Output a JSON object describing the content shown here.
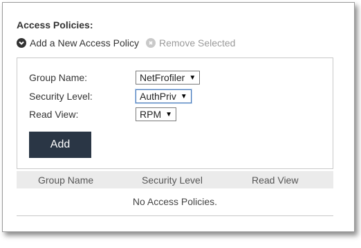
{
  "section": {
    "title": "Access Policies:"
  },
  "actions": {
    "add_label": "Add a New Access Policy",
    "remove_label": "Remove Selected"
  },
  "form": {
    "group_name": {
      "label": "Group Name:",
      "value": "NetFrofiler"
    },
    "security_level": {
      "label": "Security Level:",
      "value": "AuthPriv"
    },
    "read_view": {
      "label": "Read View:",
      "value": "RPM"
    },
    "add_button_label": "Add"
  },
  "table": {
    "columns": [
      "Group Name",
      "Security Level",
      "Read View"
    ],
    "empty_message": "No Access Policies."
  },
  "colors": {
    "button_bg": "#2a3645",
    "header_bg": "#ebebeb",
    "focus_border": "#4a7ab8"
  },
  "icons": {
    "add": "circle-chevron-down-icon",
    "remove": "circle-x-icon",
    "dropdown": "caret-down-icon"
  }
}
